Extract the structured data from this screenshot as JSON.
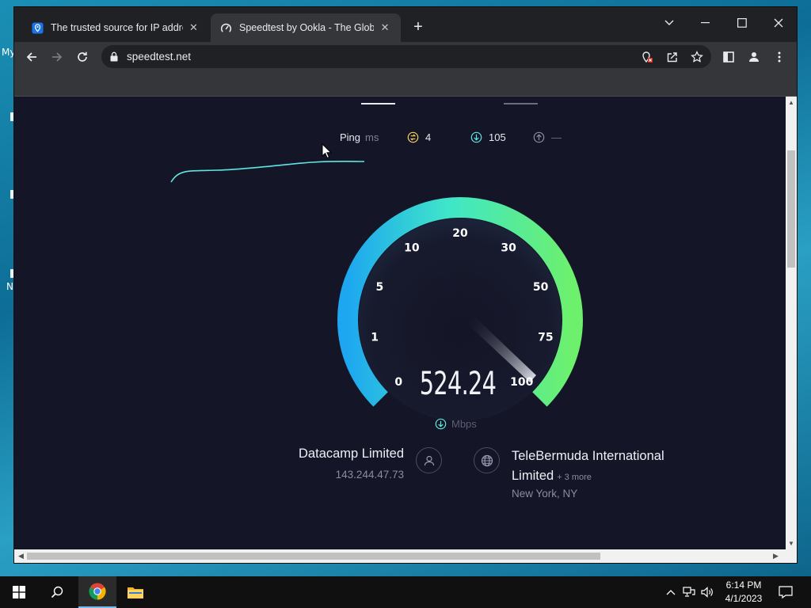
{
  "desktop": {
    "label_top": "My",
    "label_bottom": "N"
  },
  "browser": {
    "tabs": [
      {
        "title": "The trusted source for IP address",
        "icon": "shield-pin-icon"
      },
      {
        "title": "Speedtest by Ookla - The Global",
        "icon": "speedtest-icon"
      }
    ],
    "url": "speedtest.net"
  },
  "speedtest": {
    "ping_label": "Ping",
    "ping_unit": "ms",
    "jitter_value": "4",
    "download_value": "105",
    "upload_value": "—",
    "gauge_labels": [
      "0",
      "1",
      "5",
      "10",
      "20",
      "30",
      "50",
      "75",
      "100"
    ],
    "speed_value": "524.24",
    "speed_unit": "Mbps",
    "isp_name": "Datacamp Limited",
    "isp_ip": "143.244.47.73",
    "server_name": "TeleBermuda International Limited",
    "server_more": "+ 3 more",
    "server_location": "New York, NY",
    "colors": {
      "background": "#141526",
      "gauge_start": "#1ea7f0",
      "gauge_end": "#6df06c",
      "ping_line": "#5fe6e2"
    }
  },
  "taskbar": {
    "time": "6:14 PM",
    "date": "4/1/2023"
  }
}
